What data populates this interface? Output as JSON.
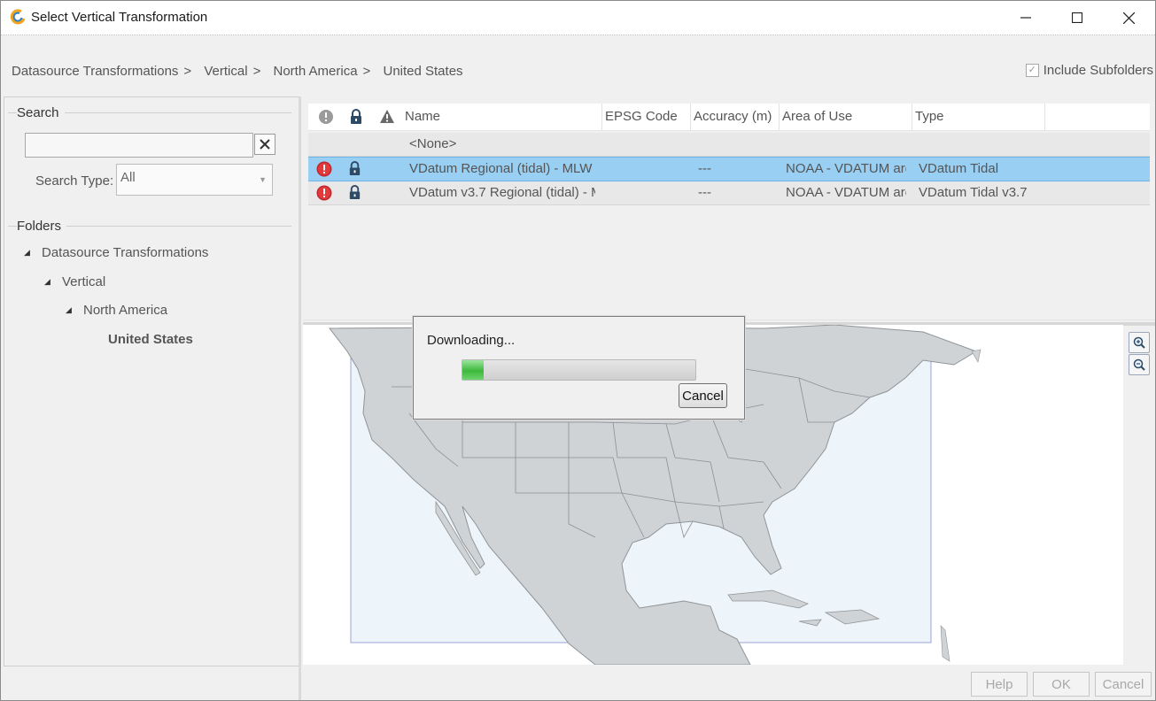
{
  "window": {
    "title": "Select Vertical Transformation",
    "minimize": "—",
    "maximize": "☐",
    "close": "✕"
  },
  "breadcrumb": {
    "items": [
      "Datasource Transformations",
      "Vertical",
      "North America",
      "United States"
    ],
    "separator": ">"
  },
  "include_subfolders": {
    "label": "Include Subfolders",
    "checked": true
  },
  "search": {
    "group_label": "Search",
    "value": "",
    "clear": "✕",
    "type_label": "Search Type:",
    "type_value": "All"
  },
  "folders": {
    "group_label": "Folders",
    "tree": [
      {
        "label": "Datasource Transformations",
        "expanded": true
      },
      {
        "label": "Vertical",
        "expanded": true
      },
      {
        "label": "North America",
        "expanded": true
      },
      {
        "label": "United States",
        "selected": true
      }
    ]
  },
  "grid": {
    "columns": [
      "Name",
      "EPSG Code",
      "Accuracy (m)",
      "Area of Use",
      "Type"
    ],
    "header_icons": [
      "status-icon",
      "lock-icon",
      "warning-icon"
    ],
    "rows": [
      {
        "name": "<None>",
        "epsg": "",
        "accuracy": "",
        "area": "",
        "type": "",
        "error": false,
        "locked": false
      },
      {
        "name": "VDatum Regional (tidal) - MLW",
        "epsg": "",
        "accuracy": "---",
        "area": "NOAA - VDATUM are",
        "type": "VDatum Tidal",
        "error": true,
        "locked": true,
        "selected": true
      },
      {
        "name": "VDatum v3.7 Regional (tidal) - M",
        "epsg": "",
        "accuracy": "---",
        "area": "NOAA - VDATUM are",
        "type": "VDatum Tidal v3.7",
        "error": true,
        "locked": true
      }
    ]
  },
  "download_dialog": {
    "message": "Downloading...",
    "progress_fraction": 0.09,
    "cancel": "Cancel"
  },
  "footer": {
    "help": "Help",
    "ok": "OK",
    "cancel": "Cancel"
  },
  "colors": {
    "selection": "#99cff2",
    "progress": "#3db83d",
    "error": "#d32020",
    "map_land": "#d0d3d5",
    "map_extent": "#eef5fa"
  }
}
